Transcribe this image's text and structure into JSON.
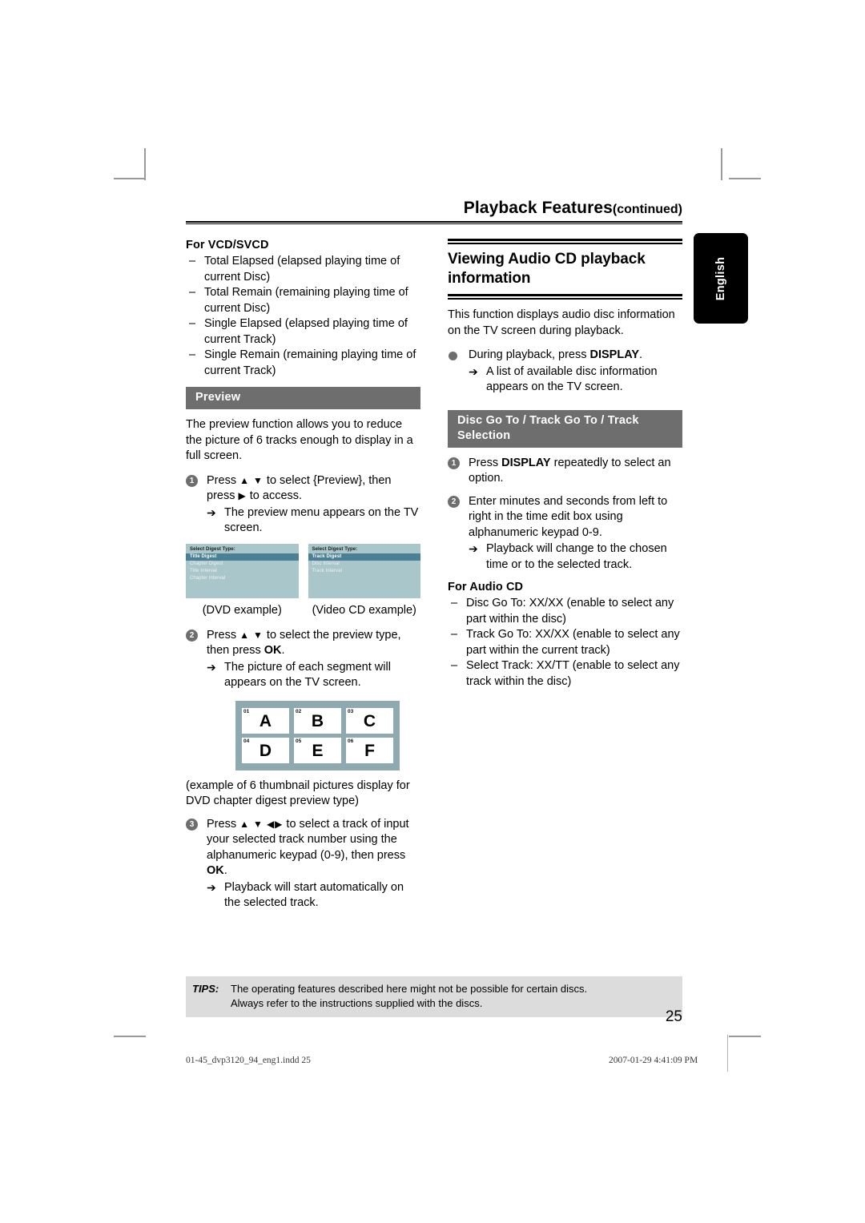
{
  "header": {
    "title": "Playback Features",
    "continued": "(continued)"
  },
  "side_tab": {
    "label": "English"
  },
  "left_column": {
    "vcd_heading": "For VCD/SVCD",
    "vcd_items": [
      "Total Elapsed (elapsed playing time of current Disc)",
      "Total Remain (remaining playing time of current Disc)",
      "Single Elapsed (elapsed playing time of current Track)",
      "Single Remain (remaining playing time of current Track)"
    ],
    "preview_bar": "Preview",
    "preview_intro": "The preview function allows you to reduce the picture of 6 tracks enough to display in a full screen.",
    "step1": {
      "num": "1",
      "text_a": "Press ",
      "up": "▲",
      "down": "▼",
      "text_b": " to select {Preview}, then press ",
      "right": "▶",
      "text_c": " to access.",
      "arrow": "➔",
      "result": "The preview menu appears on the TV screen."
    },
    "osd_dvd": {
      "title": "Select Digest Type:",
      "items": [
        "Title  Digest",
        "Chapter  Digest",
        "Title Interval",
        "Chapter Interval"
      ],
      "selected_index": 0,
      "caption": "(DVD example)"
    },
    "osd_vcd": {
      "title": "Select Digest Type:",
      "items": [
        "Track  Digest",
        "Disc Interval",
        "Track Interval"
      ],
      "selected_index": 0,
      "caption": "(Video CD example)"
    },
    "step2": {
      "num": "2",
      "text_a": "Press ",
      "up": "▲",
      "down": "▼",
      "text_b": " to select the preview type, then press ",
      "ok": "OK",
      "text_c": ".",
      "arrow": "➔",
      "result": "The picture of each segment will appears on the TV screen."
    },
    "thumbnails": [
      {
        "num": "01",
        "letter": "A"
      },
      {
        "num": "02",
        "letter": "B"
      },
      {
        "num": "03",
        "letter": "C"
      },
      {
        "num": "04",
        "letter": "D"
      },
      {
        "num": "05",
        "letter": "E"
      },
      {
        "num": "06",
        "letter": "F"
      }
    ],
    "thumb_caption": "(example of 6 thumbnail pictures display for DVD chapter digest preview type)",
    "step3": {
      "num": "3",
      "text_a": "Press ",
      "up": "▲",
      "down": "▼",
      "left": "◀",
      "right": "▶",
      "text_b": " to select a track of input your selected track number using the alphanumeric keypad (0-9), then press ",
      "ok": "OK",
      "text_c": ".",
      "arrow": "➔",
      "result": "Playback will start automatically on the selected track."
    }
  },
  "right_column": {
    "section_title": "Viewing Audio CD playback information",
    "intro": "This function displays audio disc information on the TV screen during playback.",
    "bullet": {
      "text_a": "During playback, press ",
      "display": "DISPLAY",
      "text_b": ".",
      "arrow": "➔",
      "result": "A list of available disc information appears on the TV screen."
    },
    "goto_bar": "Disc Go To / Track Go To / Track Selection",
    "step1": {
      "num": "1",
      "text_a": "Press ",
      "display": "DISPLAY",
      "text_b": " repeatedly to select an option."
    },
    "step2": {
      "num": "2",
      "text": "Enter minutes and seconds from left to right in the time edit box using alphanumeric keypad 0-9.",
      "arrow": "➔",
      "result": "Playback will change to the chosen time or to the selected track."
    },
    "audio_cd_heading": "For Audio CD",
    "audio_cd_items": [
      "Disc Go To: XX/XX (enable to select any part within the disc)",
      "Track Go To: XX/XX (enable to select any part within the current track)",
      "Select Track: XX/TT (enable to select any track within the disc)"
    ]
  },
  "tips": {
    "label": "TIPS:",
    "line1": "The operating features described here might not be possible for certain discs.",
    "line2": "Always refer to the instructions supplied with the discs."
  },
  "page_number": "25",
  "footer": {
    "file": "01-45_dvp3120_94_eng1.indd   25",
    "date": "2007-01-29   4:41:09 PM"
  }
}
